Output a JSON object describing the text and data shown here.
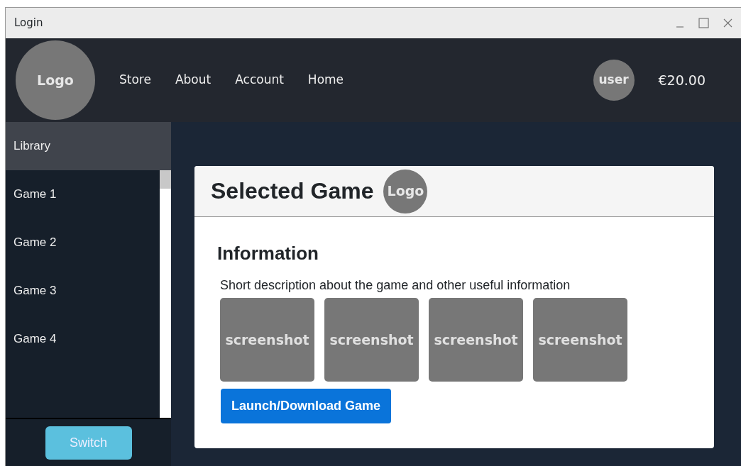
{
  "window": {
    "title": "Login"
  },
  "navbar": {
    "logo": "Logo",
    "links": [
      "Store",
      "About",
      "Account",
      "Home"
    ],
    "user": "user",
    "balance": "€20.00"
  },
  "sidebar": {
    "header": "Library",
    "items": [
      {
        "label": "Game 1",
        "selected": false
      },
      {
        "label": "Game 2",
        "selected": false
      },
      {
        "label": "Game 3",
        "selected": false
      },
      {
        "label": "Game 4",
        "selected": false
      }
    ],
    "button": "Switch"
  },
  "game": {
    "title": "Selected Game",
    "logo": "Logo",
    "heading": "Information",
    "description": "Short description about the game and other useful information",
    "screenshots": [
      "screenshot",
      "screenshot",
      "screenshot",
      "screenshot"
    ],
    "button": "Launch/Download Game"
  }
}
